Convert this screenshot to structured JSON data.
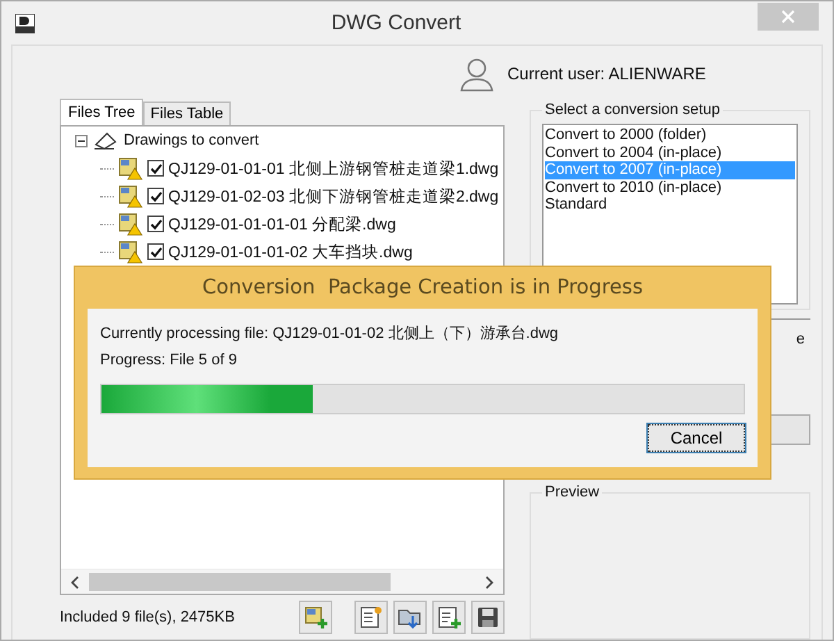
{
  "window": {
    "title": "DWG Convert"
  },
  "user": {
    "label": "Current user: ALIENWARE"
  },
  "tabs": [
    {
      "label": "Files Tree",
      "selected": true
    },
    {
      "label": "Files Table",
      "selected": false
    }
  ],
  "tree": {
    "label": "Drawings to convert",
    "expanded": true,
    "children": [
      {
        "label": "QJ129-01-01-01 北侧上游钢管桩走道梁1.dwg",
        "checked": true
      },
      {
        "label": "QJ129-01-02-03 北侧下游钢管桩走道梁2.dwg",
        "checked": true
      },
      {
        "label": "QJ129-01-01-01-01 分配梁.dwg",
        "checked": true
      },
      {
        "label": "QJ129-01-01-01-02 大车挡块.dwg",
        "checked": true
      }
    ]
  },
  "status": "Included 9 file(s), 2475KB",
  "setup": {
    "title": "Select a conversion setup",
    "options": [
      {
        "label": "Convert to 2000 (folder)",
        "selected": false
      },
      {
        "label": "Convert to 2004 (in-place)",
        "selected": false
      },
      {
        "label": "Convert to 2007 (in-place)",
        "selected": true
      },
      {
        "label": "Convert to 2010 (in-place)",
        "selected": false
      },
      {
        "label": "Standard",
        "selected": false
      }
    ]
  },
  "hidden_group_fragment": "e",
  "preview": {
    "title": "Preview"
  },
  "dialog": {
    "title": "Conversion  Package Creation is in Progress",
    "file_line": "Currently processing file: QJ129-01-01-02 北侧上（下）游承台.dwg",
    "progress_label": "Progress: File 5 of 9",
    "level": 0.33,
    "cancel": "Cancel"
  }
}
